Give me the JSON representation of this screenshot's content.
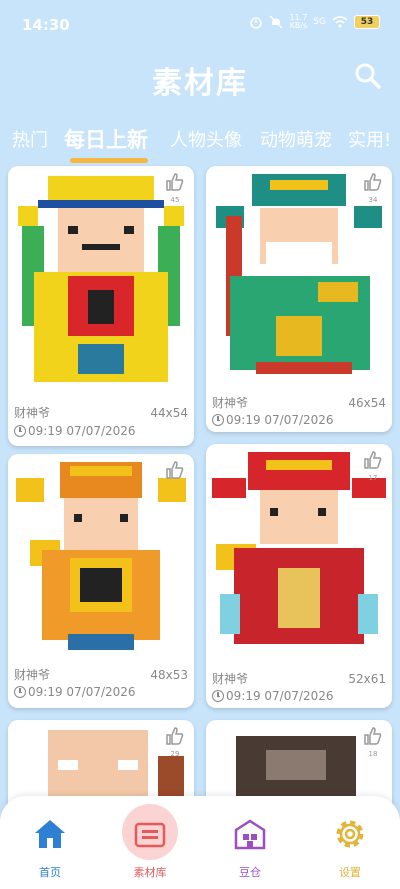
{
  "status": {
    "time": "14:30",
    "speed_top": "11.7",
    "speed_unit": "KB/s",
    "network": "5G",
    "battery": "53"
  },
  "header": {
    "title": "素材库"
  },
  "tabs": [
    {
      "label": "热门"
    },
    {
      "label": "每日上新"
    },
    {
      "label": "人物头像"
    },
    {
      "label": "动物萌宠"
    },
    {
      "label": "实用!"
    }
  ],
  "cards": [
    {
      "name": "财神爷",
      "size": "44x54",
      "date": "09:19 07/07/2026",
      "likes": "45"
    },
    {
      "name": "财神爷",
      "size": "46x54",
      "date": "09:19 07/07/2026",
      "likes": "34"
    },
    {
      "name": "财神爷",
      "size": "48x53",
      "date": "09:19 07/07/2026",
      "likes": ""
    },
    {
      "name": "财神爷",
      "size": "52x61",
      "date": "09:19 07/07/2026",
      "likes": "17"
    },
    {
      "name": "",
      "size": "",
      "date": "",
      "likes": "29"
    },
    {
      "name": "",
      "size": "",
      "date": "",
      "likes": "18"
    }
  ],
  "nav": [
    {
      "label": "首页",
      "icon": "home-icon",
      "color": "#2f7fd4"
    },
    {
      "label": "素材库",
      "icon": "library-icon",
      "color": "#e45a5a"
    },
    {
      "label": "豆仓",
      "icon": "warehouse-icon",
      "color": "#9b4fc2"
    },
    {
      "label": "设置",
      "icon": "gear-icon",
      "color": "#e2b43a"
    }
  ],
  "colors": {
    "background": "#c8e4fa",
    "accent": "#f4b840"
  }
}
